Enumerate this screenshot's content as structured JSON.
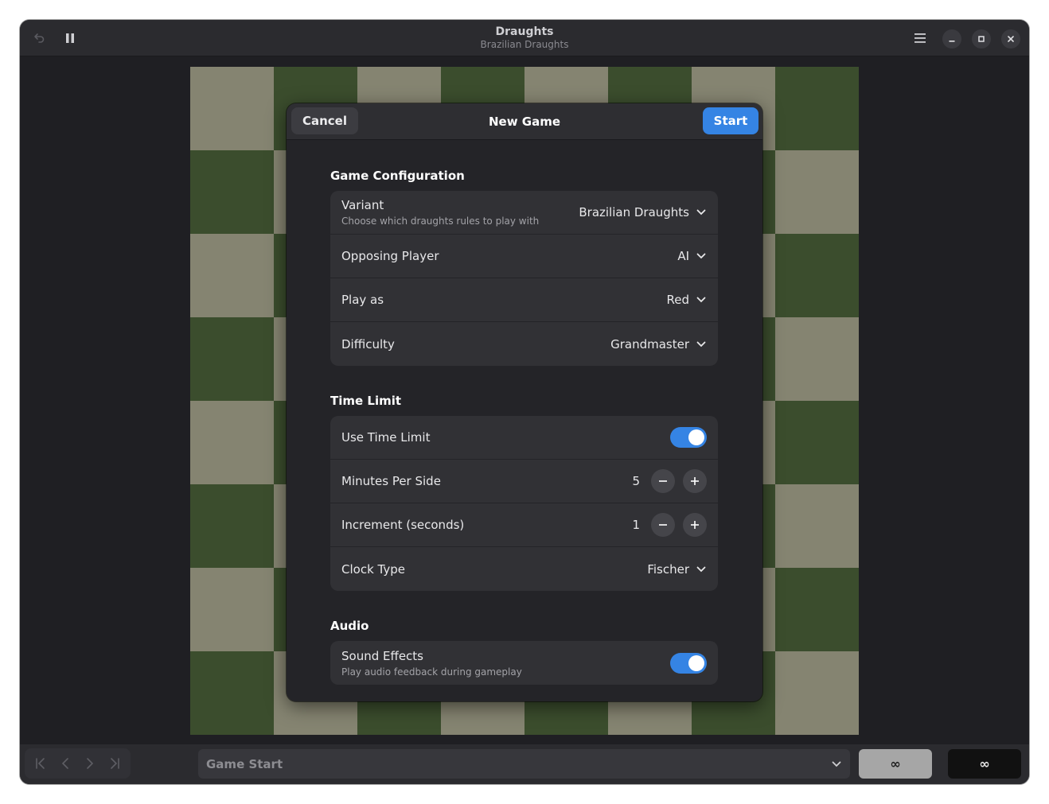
{
  "window": {
    "title": "Draughts",
    "subtitle": "Brazilian Draughts"
  },
  "headerbar": {
    "icons": [
      "undo-icon",
      "pause-icon",
      "hamburger-menu-icon",
      "minimize-icon",
      "maximize-icon",
      "close-icon"
    ]
  },
  "board": {
    "light_color": "#858471",
    "dark_color": "#3b4d2d"
  },
  "dialog": {
    "cancel_label": "Cancel",
    "title": "New Game",
    "start_label": "Start",
    "accent_color": "#3584e4",
    "sections": {
      "game_config": {
        "title": "Game Configuration",
        "variant": {
          "label": "Variant",
          "subtitle": "Choose which draughts rules to play with",
          "value": "Brazilian Draughts"
        },
        "opposing": {
          "label": "Opposing Player",
          "value": "AI"
        },
        "play_as": {
          "label": "Play as",
          "value": "Red"
        },
        "difficulty": {
          "label": "Difficulty",
          "value": "Grandmaster"
        }
      },
      "time_limit": {
        "title": "Time Limit",
        "use_time_limit": {
          "label": "Use Time Limit",
          "enabled": true
        },
        "minutes": {
          "label": "Minutes Per Side",
          "value": "5"
        },
        "increment": {
          "label": "Increment (seconds)",
          "value": "1"
        },
        "clock_type": {
          "label": "Clock Type",
          "value": "Fischer"
        }
      },
      "audio": {
        "title": "Audio",
        "sound_effects": {
          "label": "Sound Effects",
          "subtitle": "Play audio feedback during gameplay",
          "enabled": true
        }
      }
    }
  },
  "bottombar": {
    "nav_icons": [
      "first-move-icon",
      "previous-move-icon",
      "next-move-icon",
      "last-move-icon"
    ],
    "move_select_value": "Game Start",
    "clock_light": "∞",
    "clock_dark": "∞"
  }
}
